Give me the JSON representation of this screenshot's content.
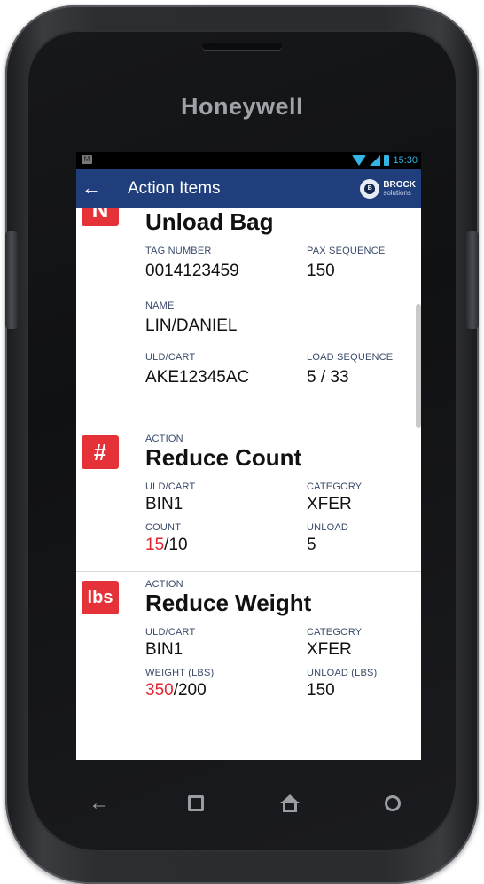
{
  "device": {
    "brand": "Honeywell"
  },
  "statusbar": {
    "time": "15:30",
    "left_icon": "M"
  },
  "actionbar": {
    "title": "Action Items",
    "back_icon": "arrow-left-icon",
    "logo": {
      "name": "BROCK",
      "sub": "solutions"
    }
  },
  "cards": [
    {
      "badge": "N",
      "title": "Unload Bag",
      "fields": [
        {
          "label": "TAG NUMBER",
          "value": "0014123459"
        },
        {
          "label": "PAX SEQUENCE",
          "value": "150"
        },
        {
          "label": "NAME",
          "value": "LIN/DANIEL"
        },
        {
          "label": "ULD/CART",
          "value": "AKE12345AC"
        },
        {
          "label": "LOAD SEQUENCE",
          "value": "5 / 33"
        }
      ]
    },
    {
      "badge": "#",
      "action_label": "ACTION",
      "title": "Reduce Count",
      "fields": [
        {
          "label": "ULD/CART",
          "value": "BIN1"
        },
        {
          "label": "CATEGORY",
          "value": "XFER"
        },
        {
          "label": "COUNT",
          "value_current": "15",
          "value_target": "/10"
        },
        {
          "label": "UNLOAD",
          "value": "5"
        }
      ]
    },
    {
      "badge": "lbs",
      "action_label": "ACTION",
      "title": "Reduce Weight",
      "fields": [
        {
          "label": "ULD/CART",
          "value": "BIN1"
        },
        {
          "label": "CATEGORY",
          "value": "XFER"
        },
        {
          "label": "WEIGHT (LBS)",
          "value_current": "350",
          "value_target": "/200"
        },
        {
          "label": "UNLOAD (LBS)",
          "value": "150"
        }
      ]
    }
  ],
  "navbar": {
    "items": [
      "back-nav-icon",
      "recent-apps-icon",
      "home-icon",
      "search-icon"
    ]
  },
  "colors": {
    "accent": "#1f3e7b",
    "badge": "#e53138",
    "alert": "#e0262e"
  }
}
